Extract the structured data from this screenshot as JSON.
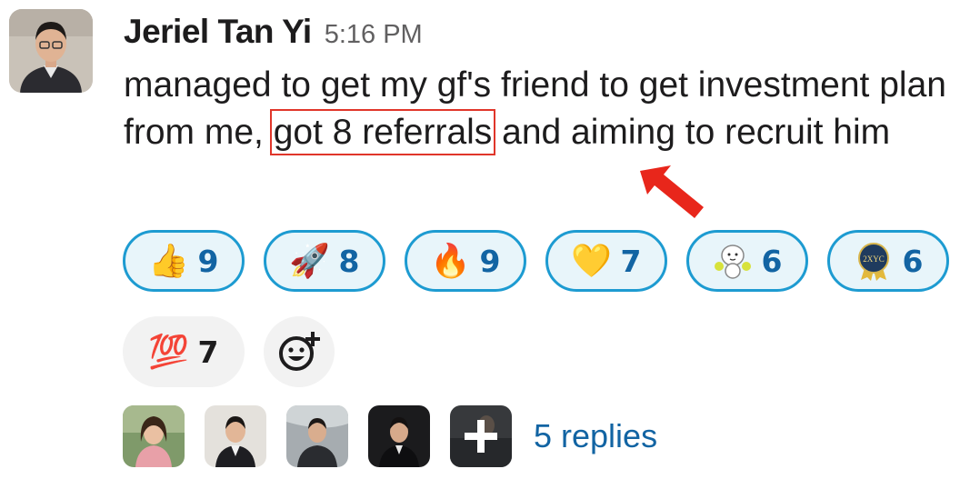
{
  "message": {
    "author": "Jeriel Tan Yi",
    "time": "5:16 PM",
    "text_before": "managed to get my gf's friend to get investment plan from me, ",
    "text_highlight": "got 8 referrals",
    "text_after": " and aiming to recruit him"
  },
  "reactions": [
    {
      "icon": "thumbs-up-icon",
      "count": "9"
    },
    {
      "icon": "rocket-icon",
      "count": "8"
    },
    {
      "icon": "fire-icon",
      "count": "9"
    },
    {
      "icon": "yellow-heart-icon",
      "count": "7"
    },
    {
      "icon": "cheer-mascot-icon",
      "count": "6"
    },
    {
      "icon": "badge-icon",
      "count": "6"
    },
    {
      "icon": "hundred-points-icon",
      "count": "7"
    }
  ],
  "badge_text": "2XYC",
  "add_reaction_icon": "add-reaction-icon",
  "thread": {
    "replies": "5 replies"
  },
  "colors": {
    "accent": "#1264a3",
    "reaction_border": "#1d9bd1",
    "reaction_bg": "#e8f5fa",
    "highlight": "#e0362a"
  }
}
